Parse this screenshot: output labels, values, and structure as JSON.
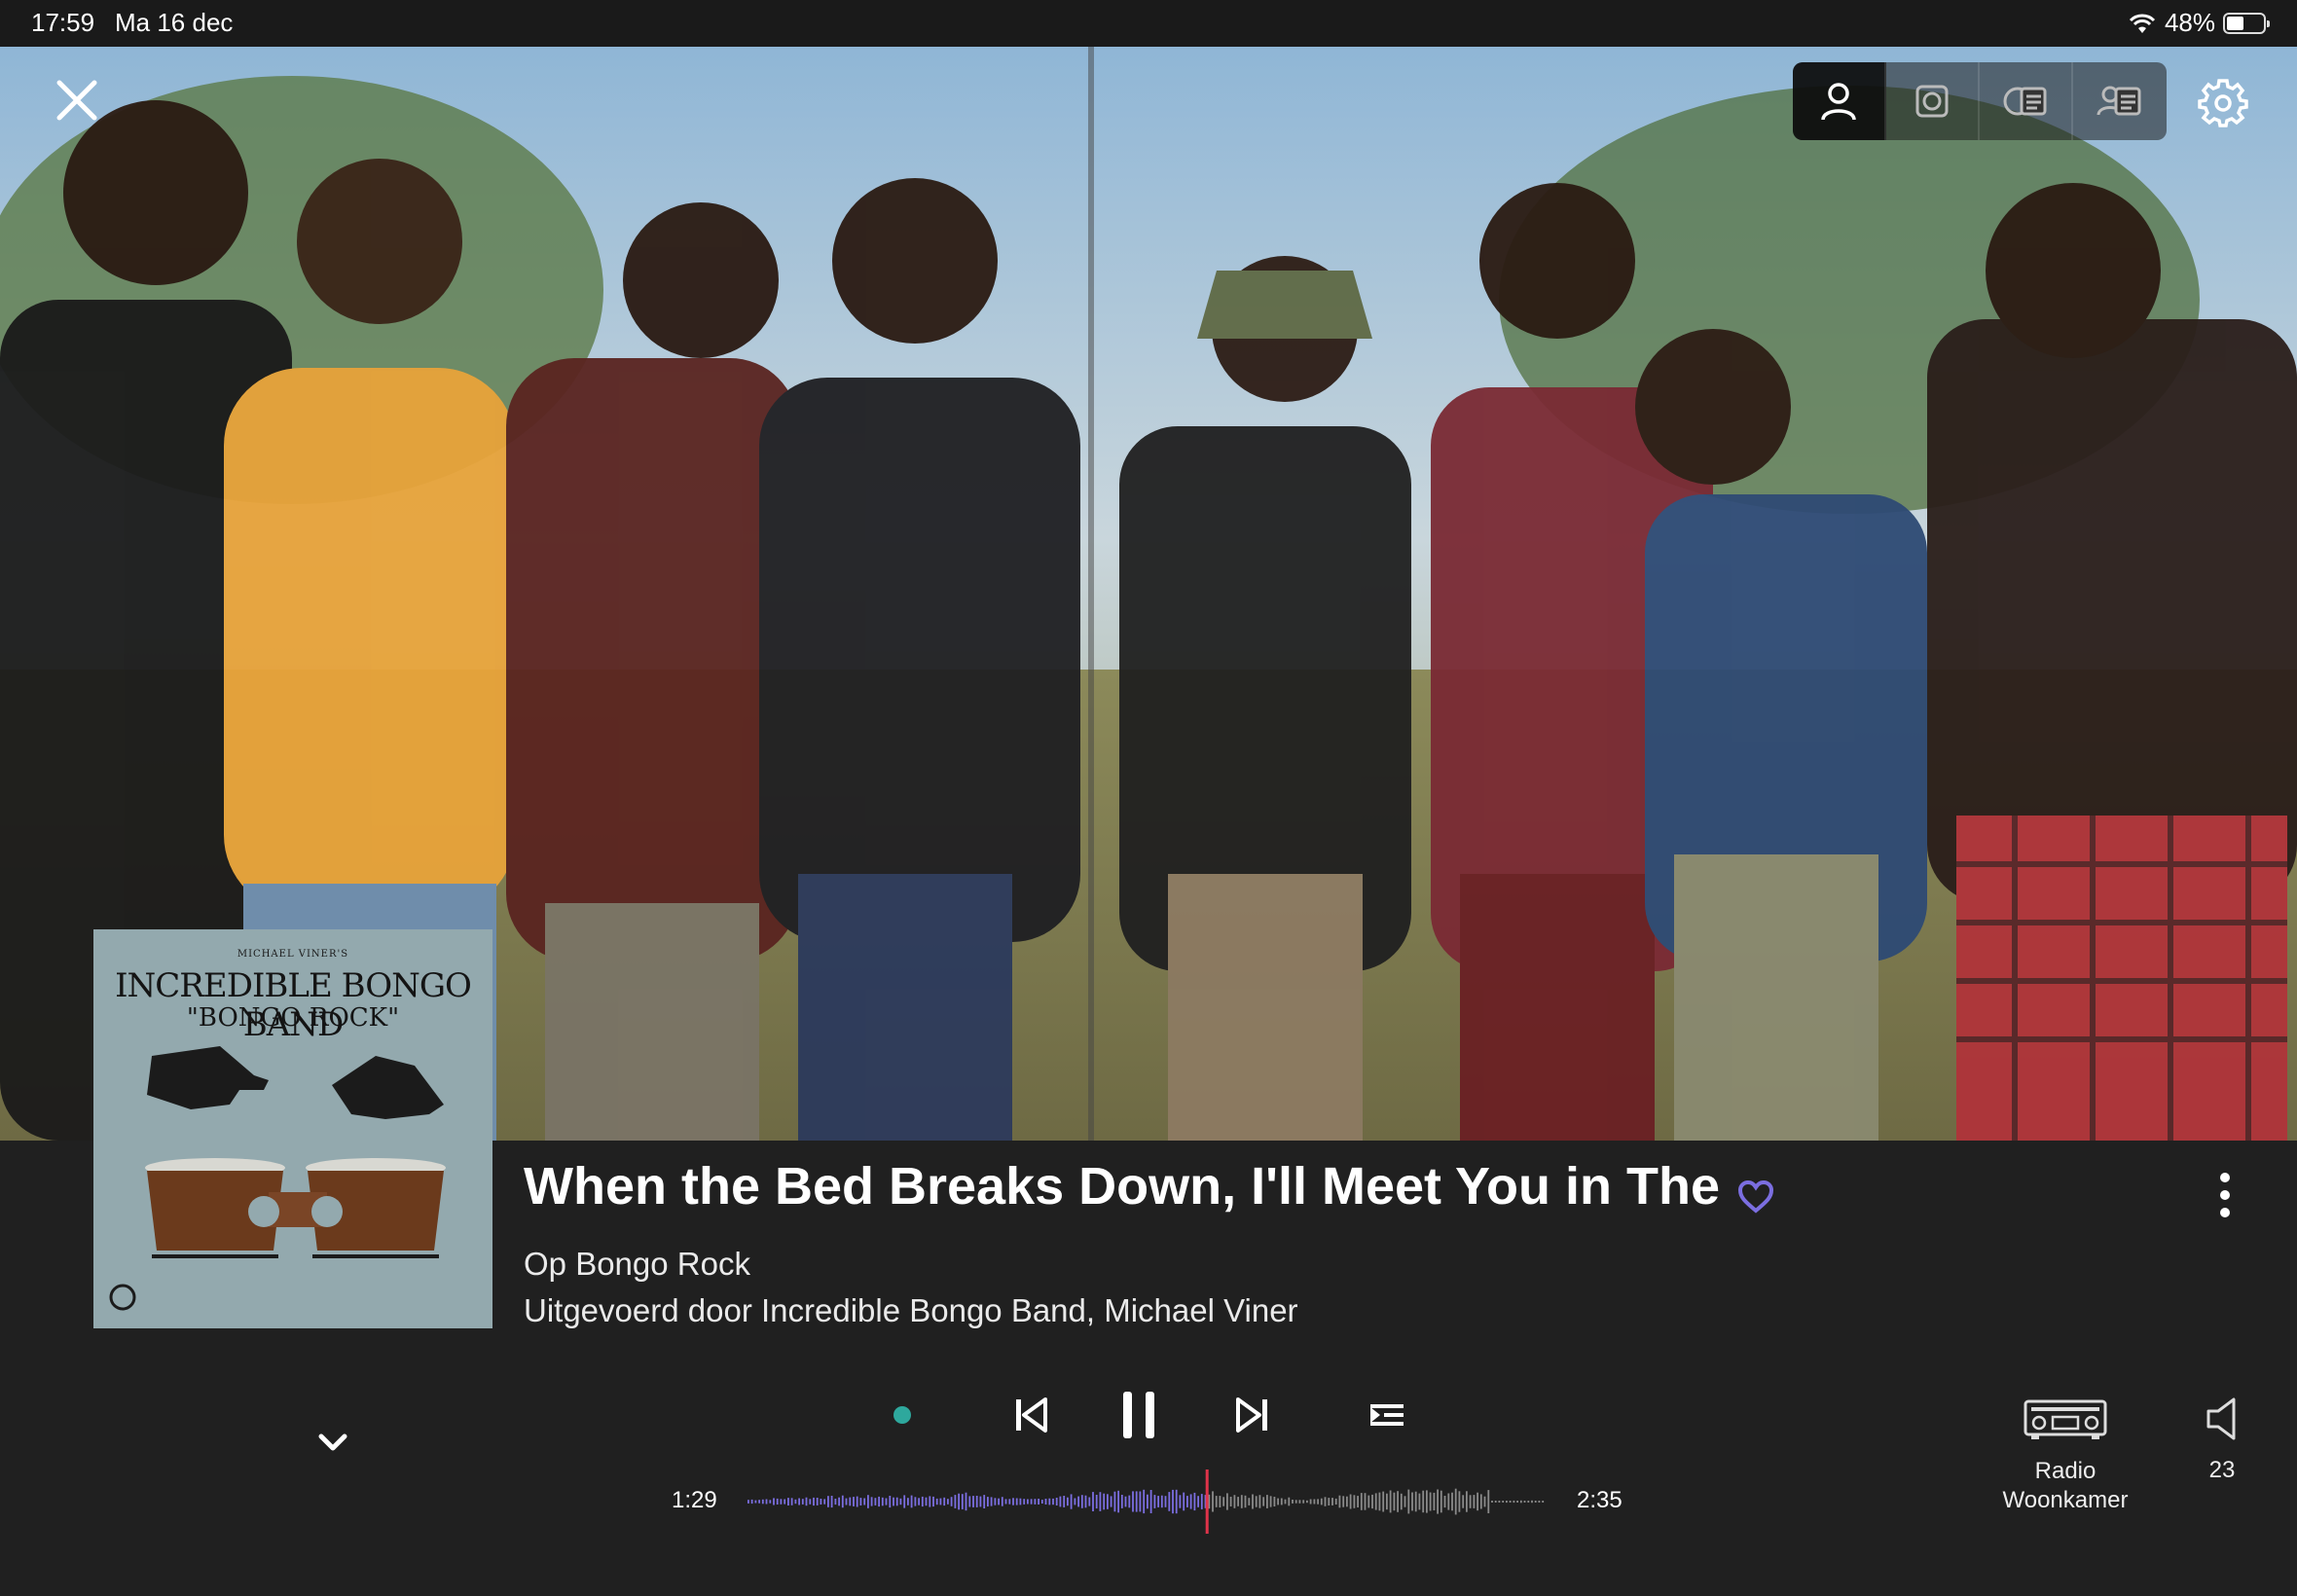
{
  "status_bar": {
    "time": "17:59",
    "date": "Ma 16 dec",
    "battery": "48%",
    "battery_level": 0.48
  },
  "hero": {
    "view_toggle": [
      "artist-icon",
      "disc-icon",
      "album-info-icon",
      "artist-info-icon"
    ],
    "active_view": "artist-icon"
  },
  "now_playing": {
    "title": "When the Bed Breaks Down, I'll Meet You in The",
    "album_line": "Op Bongo Rock",
    "artist_line": "Uitgevoerd door Incredible Bongo Band, Michael Viner",
    "favorite": true,
    "cover": {
      "small": "MICHAEL VINER'S",
      "title": "INCREDIBLE BONGO BAND",
      "subtitle": "\"BONGO ROCK\""
    }
  },
  "playback": {
    "current_time": "1:29",
    "total_time": "2:35",
    "progress": 0.574,
    "state": "playing"
  },
  "output": {
    "device_name": "Radio\nWoonkamer",
    "volume": "23"
  },
  "colors": {
    "accent_purple": "#7b6ee0",
    "playhead_red": "#e0334a",
    "status_dot_teal": "#2ea89d",
    "panel_bg": "#202020"
  }
}
